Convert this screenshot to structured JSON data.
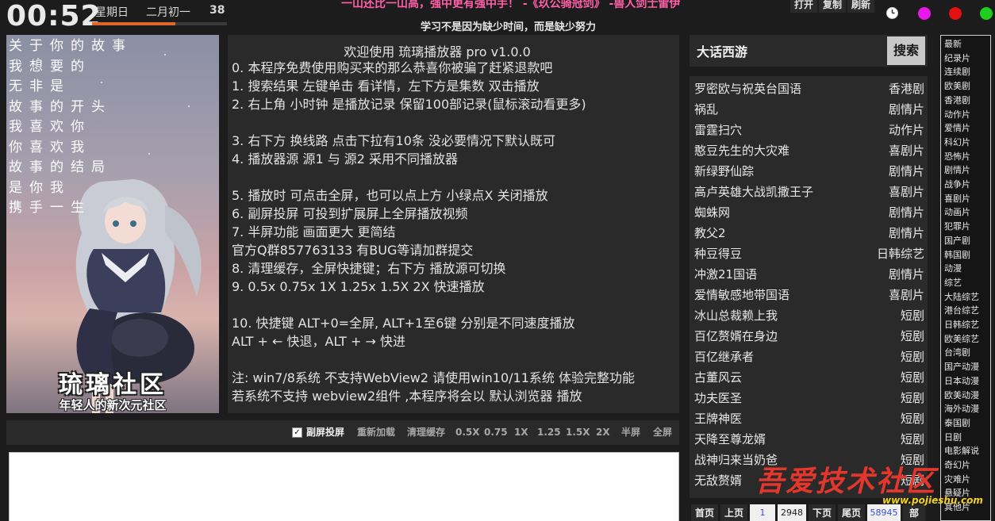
{
  "top": {
    "clock": "00:52",
    "weekday": "星期日",
    "lunar_date": "二月初一",
    "week_number": "38",
    "progress": 0.62,
    "poem": "一山还比一山高，强中更有强中手！ -《玖公骑冠剑》 -兽人剑士雷伊",
    "motto": "学习不是因为缺少时间，而是缺少努力",
    "buttons": [
      "打开",
      "复制",
      "刷新"
    ],
    "history_icon": "clock-icon",
    "dot_colors": [
      "#e818e8",
      "#e01212",
      "#1dce1d"
    ]
  },
  "poster": {
    "verses": [
      "关于你的故事",
      "我想要的",
      "无非是",
      "故事的开头",
      "我喜欢你",
      "你喜欢我",
      "故事的结局",
      "是你我",
      "携手一生"
    ],
    "brand": "琉璃社区",
    "slogan": "年轻人的新次元社区"
  },
  "info": {
    "title": "欢迎使用 琉璃播放器 pro v1.0.0",
    "lines": [
      "0. 本程序免费使用购买来的那么恭喜你被骗了赶紧退款吧",
      "1. 搜索结果 左键单击 看详情，左下方是集数 双击播放",
      "2. 右上角 小时钟 是播放记录 保留100部记录(鼠标滚动看更多)",
      "",
      "3. 右下方 换线路 点击下拉有10条 没必要情况下默认既可",
      "4. 播放器源 源1 与 源2 采用不同播放器",
      "",
      "5. 播放时 可点击全屏，也可以点上方 小绿点X 关闭播放",
      "6. 副屏投屏 可投到扩展屏上全屏播放视频",
      "7. 半屏功能 画面更大 更简结",
      "       官方Q群857763133 有BUG等请加群提交",
      "8. 清理缓存，全屏快捷键；右下方 播放源可切换",
      "9. 0.5x 0.75x 1X 1.25x 1.5X  2X  快速播放",
      "",
      "10. 快捷键 ALT+0=全屏, ALT+1至6键 分别是不同速度播放",
      "      ALT + ← 快退，ALT + → 快进",
      "",
      "注: win7/8系统 不支持WebView2 请使用win10/11系统 体验完整功能",
      "     若系统不支持 webview2组件 ,本程序将会以 默认浏览器 播放"
    ]
  },
  "controls": {
    "cast_checked": true,
    "cast": "副屏投屏",
    "reload": "重新加载",
    "clear_cache": "清理缓存",
    "speeds": [
      "0.5X",
      "0.75",
      "1X",
      "1.25",
      "1.5X",
      "2X"
    ],
    "half_screen": "半屏",
    "full_screen": "全屏"
  },
  "search": {
    "query": "大话西游",
    "button": "搜索"
  },
  "results": [
    {
      "title": "罗密欧与祝英台国语",
      "genre": "香港剧"
    },
    {
      "title": "祸乱",
      "genre": "剧情片"
    },
    {
      "title": "雷霆扫穴",
      "genre": "动作片"
    },
    {
      "title": "憨豆先生的大灾难",
      "genre": "喜剧片"
    },
    {
      "title": "新绿野仙踪",
      "genre": "剧情片"
    },
    {
      "title": "高卢英雄大战凯撒王子",
      "genre": "喜剧片"
    },
    {
      "title": "蜘蛛网",
      "genre": "剧情片"
    },
    {
      "title": "教父2",
      "genre": "剧情片"
    },
    {
      "title": "种豆得豆",
      "genre": "日韩综艺"
    },
    {
      "title": "冲激21国语",
      "genre": "剧情片"
    },
    {
      "title": "爱情敏感地带国语",
      "genre": "喜剧片"
    },
    {
      "title": "冰山总裁赖上我",
      "genre": "短剧"
    },
    {
      "title": "百亿赘婿在身边",
      "genre": "短剧"
    },
    {
      "title": "百亿继承者",
      "genre": "短剧"
    },
    {
      "title": "古董风云",
      "genre": "短剧"
    },
    {
      "title": "功夫医圣",
      "genre": "短剧"
    },
    {
      "title": "王牌神医",
      "genre": "短剧"
    },
    {
      "title": "天降至尊龙婿",
      "genre": "短剧"
    },
    {
      "title": "战神归来当奶爸",
      "genre": "短剧"
    },
    {
      "title": "无敌赘婿",
      "genre": "短剧"
    }
  ],
  "pager": {
    "first": "首页",
    "prev": "上页",
    "current": "1",
    "total": "2948",
    "next": "下页",
    "last": "尾页",
    "count": "58945",
    "unit": "部"
  },
  "categories": [
    "最新",
    "纪录片",
    "连续剧",
    "欧美剧",
    "香港剧",
    "动作片",
    "爱情片",
    "科幻片",
    "恐怖片",
    "剧情片",
    "战争片",
    "喜剧片",
    "动画片",
    "犯罪片",
    "国产剧",
    "韩国剧",
    "动漫",
    "综艺",
    "大陆综艺",
    "港台综艺",
    "日韩综艺",
    "欧美综艺",
    "台湾剧",
    "国产动漫",
    "日本动漫",
    "欧美动漫",
    "海外动漫",
    "泰国剧",
    "日剧",
    "电影解说",
    "奇幻片",
    "灾难片",
    "悬疑片",
    "其他片"
  ],
  "watermark": {
    "text": "吾爱技术社区",
    "url": "www.pojieshu.com"
  }
}
